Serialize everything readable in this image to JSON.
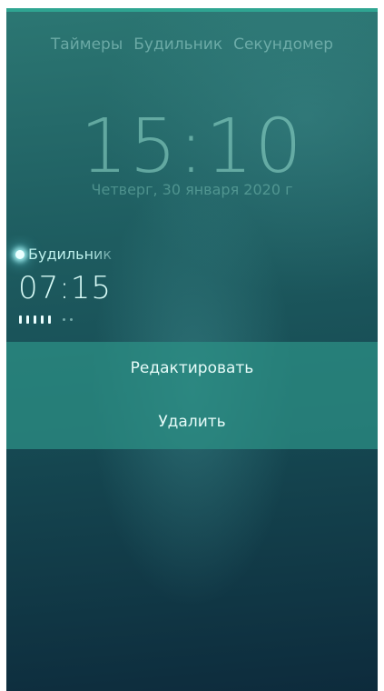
{
  "tabs": [
    {
      "label": "Таймеры"
    },
    {
      "label": "Будильник"
    },
    {
      "label": "Секундомер"
    }
  ],
  "clock": {
    "time": "15:10",
    "date": "Четверг, 30 января 2020 г"
  },
  "alarm": {
    "label": "Будильник",
    "time": "07:15",
    "enabled": true,
    "days_active": [
      true,
      true,
      true,
      true,
      true,
      false,
      false
    ]
  },
  "context_menu": {
    "edit_label": "Редактировать",
    "delete_label": "Удалить"
  },
  "colors": {
    "accent": "#2fa592",
    "highlight": "#bff2ee",
    "background_top": "#2c7773",
    "background_bottom": "#0d2b3c"
  }
}
